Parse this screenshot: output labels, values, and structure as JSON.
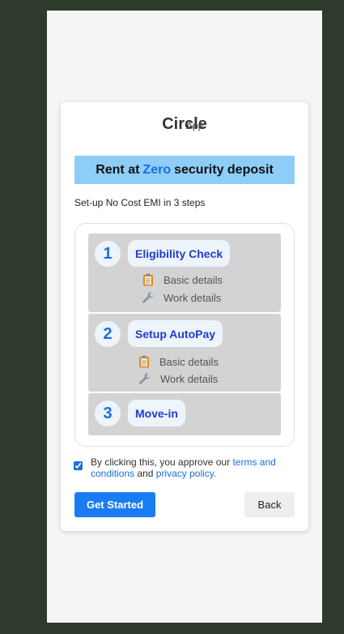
{
  "brand": {
    "name": "Circle",
    "sub": "App"
  },
  "banner": {
    "pre": "Rent at",
    "highlight": "Zero",
    "post": "security deposit"
  },
  "steps_heading": "Set-up No Cost EMI in 3 steps",
  "steps": [
    {
      "num": "1",
      "title": "Eligibility Check",
      "details": [
        {
          "icon": "clipboard-icon",
          "label": "Basic details"
        },
        {
          "icon": "wrench-icon",
          "label": "Work details"
        }
      ]
    },
    {
      "num": "2",
      "title": "Setup AutoPay",
      "details": [
        {
          "icon": "clipboard-icon",
          "label": "Basic details"
        },
        {
          "icon": "wrench-icon",
          "label": "Work details"
        }
      ]
    },
    {
      "num": "3",
      "title": "Move-in",
      "details": []
    }
  ],
  "consent": {
    "checked": true,
    "pre": "By clicking this, you approve our",
    "terms_link": "terms and conditions",
    "mid": "and",
    "privacy_link": "privacy policy",
    "end": "."
  },
  "buttons": {
    "primary": "Get Started",
    "secondary": "Back"
  },
  "colors": {
    "accent": "#1a7cf2",
    "banner": "#8dcdf8",
    "step_bg": "#d3d3d3",
    "step_title": "#1f3ec7"
  }
}
